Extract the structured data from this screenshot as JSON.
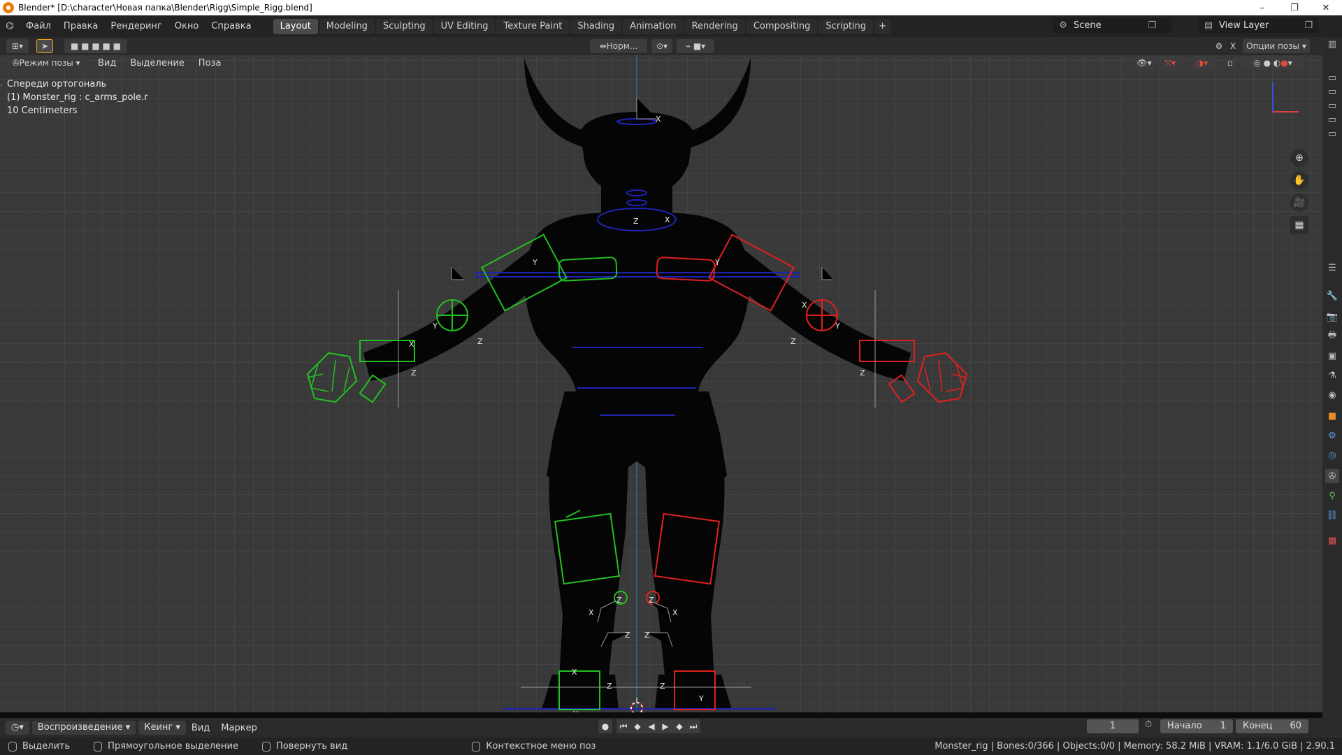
{
  "window": {
    "title": "Blender* [D:\\character\\Новая папка\\Blender\\Rigg\\Simple_Rigg.blend]",
    "controls": [
      "–",
      "❐",
      "✕"
    ]
  },
  "menu": [
    "Файл",
    "Правка",
    "Рендеринг",
    "Окно",
    "Справка"
  ],
  "workspaces": [
    {
      "label": "Layout",
      "active": true
    },
    {
      "label": "Modeling",
      "active": false
    },
    {
      "label": "Sculpting",
      "active": false
    },
    {
      "label": "UV Editing",
      "active": false
    },
    {
      "label": "Texture Paint",
      "active": false
    },
    {
      "label": "Shading",
      "active": false
    },
    {
      "label": "Animation",
      "active": false
    },
    {
      "label": "Rendering",
      "active": false
    },
    {
      "label": "Compositing",
      "active": false
    },
    {
      "label": "Scripting",
      "active": false
    }
  ],
  "scene": {
    "name": "Scene",
    "view_layer": "View Layer"
  },
  "viewport_header": {
    "transform_orientation": "Норм...",
    "options_label": "Опции позы"
  },
  "mode_bar": {
    "mode": "Режим позы",
    "menus": [
      "Вид",
      "Выделение",
      "Поза"
    ]
  },
  "overlay_text": {
    "view": "Спереди ортогональ",
    "object": "(1) Monster_rig : c_arms_pole.r",
    "scale": "10 Centimeters"
  },
  "axis_labels": {
    "x": "X",
    "y": "Y",
    "z": "Z"
  },
  "timeline": {
    "playback": "Воспроизведение",
    "keying": "Кеинг",
    "menus": [
      "Вид",
      "Маркер"
    ],
    "current_frame": "1",
    "start_label": "Начало",
    "start": "1",
    "end_label": "Конец",
    "end": "60"
  },
  "statusbar": {
    "select": "Выделить",
    "box_select": "Прямоугольное выделение",
    "rotate": "Повернуть вид",
    "context": "Контекстное меню поз",
    "info": "Monster_rig | Bones:0/366 | Objects:0/0 | Memory: 58.2 MiB | VRAM: 1.1/6.0 GiB | 2.90.1"
  },
  "colors": {
    "left_ctrl": "#22c022",
    "right_ctrl": "#e02020",
    "center_ctrl": "#2020c0"
  }
}
